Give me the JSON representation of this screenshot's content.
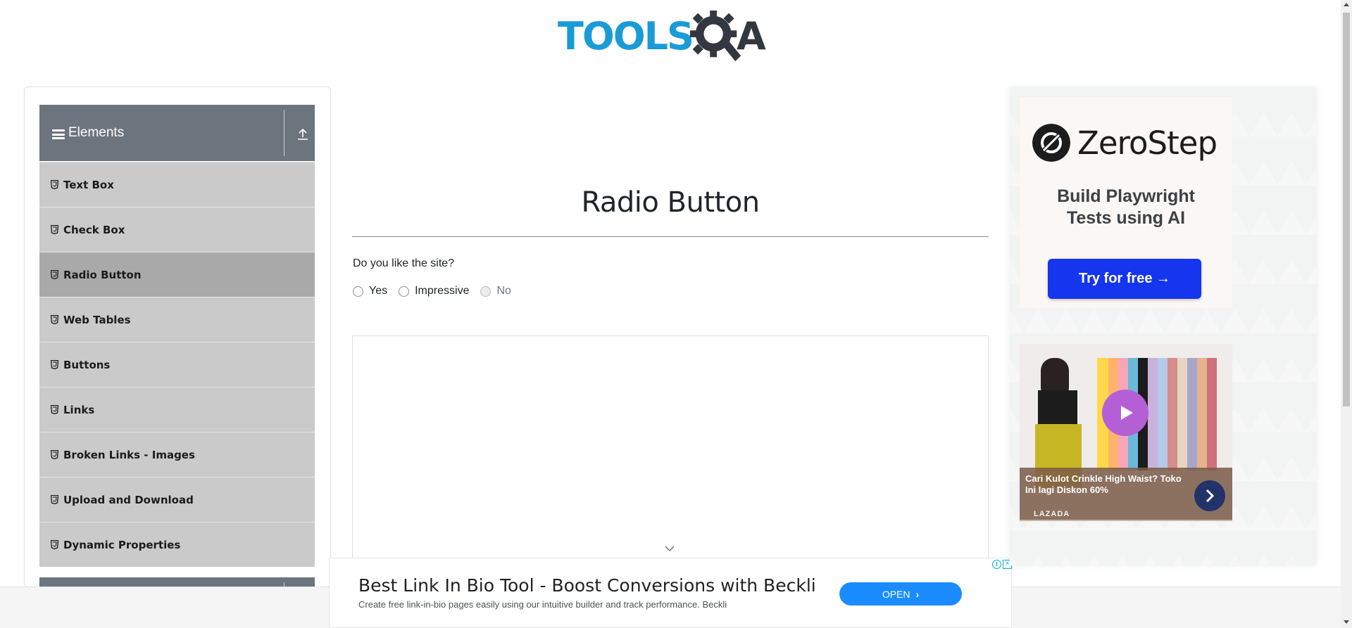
{
  "header": {
    "logo_text": "TOOLS",
    "logo_suffix": "A",
    "logo_alt": "TOOLSQA"
  },
  "sidebar": {
    "group_title": "Elements",
    "items": [
      {
        "label": "Text Box",
        "active": false
      },
      {
        "label": "Check Box",
        "active": false
      },
      {
        "label": "Radio Button",
        "active": true
      },
      {
        "label": "Web Tables",
        "active": false
      },
      {
        "label": "Buttons",
        "active": false
      },
      {
        "label": "Links",
        "active": false
      },
      {
        "label": "Broken Links - Images",
        "active": false
      },
      {
        "label": "Upload and Download",
        "active": false
      },
      {
        "label": "Dynamic Properties",
        "active": false
      }
    ]
  },
  "main": {
    "title": "Radio Button",
    "question": "Do you like the site?",
    "options": [
      {
        "label": "Yes",
        "disabled": false,
        "checked": false
      },
      {
        "label": "Impressive",
        "disabled": false,
        "checked": false
      },
      {
        "label": "No",
        "disabled": true,
        "checked": false
      }
    ]
  },
  "bottom_ad": {
    "headline": "Best Link In Bio Tool - Boost Conversions with Beckli",
    "description": "Create free link-in-bio pages easily using our intuitive builder and track performance. Beckli",
    "button_label": "OPEN"
  },
  "right_ads": {
    "zerostep": {
      "brand": "ZeroStep",
      "tagline_line1": "Build Playwright",
      "tagline_line2": "Tests using AI",
      "button_label": "Try for free →"
    },
    "lazada": {
      "caption": "Cari Kulot Crinkle High Waist? Toko Ini lagi Diskon 60%",
      "brand": "LAZADA"
    }
  },
  "colors": {
    "logo_blue": "#1a9bd7",
    "logo_dark": "#333840",
    "sidebar_header": "#6c757d",
    "sidebar_item": "#cacaca",
    "sidebar_item_active": "#a9a9a9",
    "zerostep_button": "#1535ef",
    "ad_open_button": "#1a8cff"
  },
  "icons": {
    "menu": "hamburger-icon",
    "collapse": "upload-arrow-icon",
    "item": "html5-badge-icon",
    "ad_next": "chevron-right-icon",
    "ad_play": "play-icon"
  }
}
